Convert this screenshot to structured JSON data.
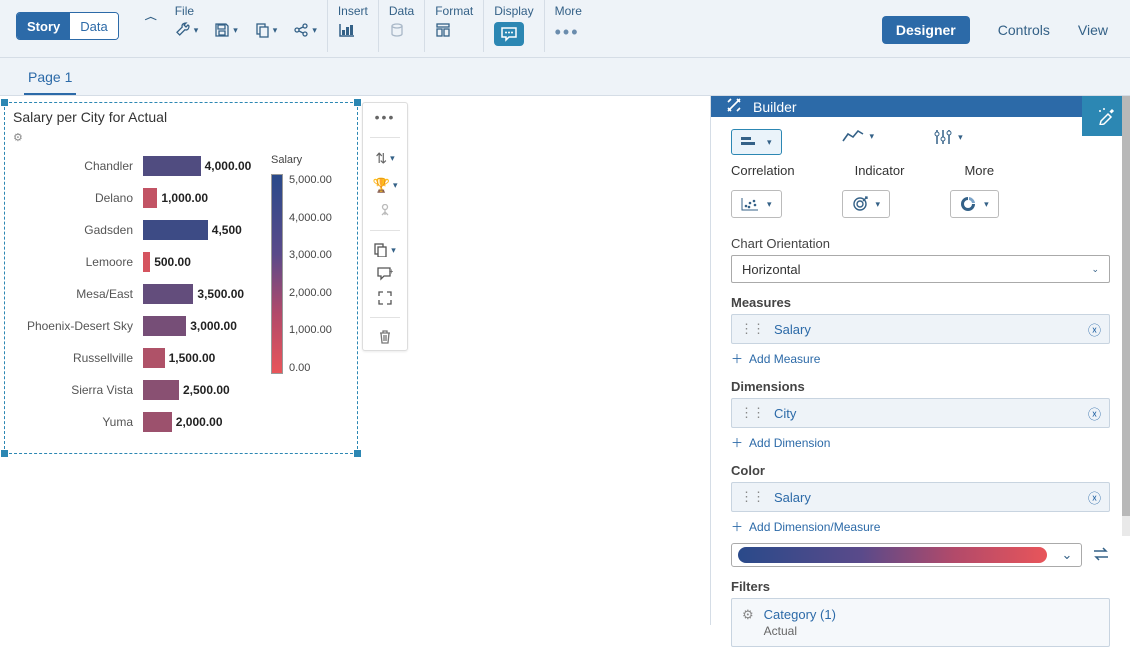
{
  "mode_toggle": {
    "story": "Story",
    "data": "Data"
  },
  "menu": {
    "file": "File",
    "insert": "Insert",
    "data": "Data",
    "format": "Format",
    "display": "Display",
    "more": "More"
  },
  "right_links": {
    "designer": "Designer",
    "controls": "Controls",
    "view": "View"
  },
  "page_tab": "Page 1",
  "chart": {
    "title": "Salary per City for Actual",
    "legend_title": "Salary"
  },
  "chart_data": {
    "type": "bar",
    "orientation": "horizontal",
    "title": "Salary per City for Actual",
    "color_measure": "Salary",
    "color_scale": {
      "min": 0,
      "max": 5000,
      "low_color": "#e8555a",
      "high_color": "#2a4a8a"
    },
    "xlabel": "",
    "ylabel": "",
    "xlim": [
      0,
      5000
    ],
    "categories": [
      "Chandler",
      "Delano",
      "Gadsden",
      "Lemoore",
      "Mesa/East",
      "Phoenix-Desert Sky",
      "Russellville",
      "Sierra Vista",
      "Yuma"
    ],
    "values": [
      4000,
      1000,
      4500,
      500,
      3500,
      3000,
      1500,
      2500,
      2000
    ],
    "value_labels": [
      "4,000.00",
      "1,000.00",
      "4,500",
      "500.00",
      "3,500.00",
      "3,000.00",
      "1,500.00",
      "2,500.00",
      "2,000.00"
    ],
    "legend_ticks": [
      "5,000.00",
      "4,000.00",
      "3,000.00",
      "2,000.00",
      "1,000.00",
      "0.00"
    ]
  },
  "builder": {
    "header": "Builder",
    "type_correlation": "Correlation",
    "type_indicator": "Indicator",
    "type_more": "More",
    "orientation_label": "Chart Orientation",
    "orientation_value": "Horizontal",
    "measures_label": "Measures",
    "measure_chip": "Salary",
    "add_measure": "Add Measure",
    "dimensions_label": "Dimensions",
    "dimension_chip": "City",
    "add_dimension": "Add Dimension",
    "color_label": "Color",
    "color_chip": "Salary",
    "add_dim_measure": "Add Dimension/Measure",
    "filters_label": "Filters",
    "filter_title": "Category (1)",
    "filter_sub": "Actual"
  }
}
